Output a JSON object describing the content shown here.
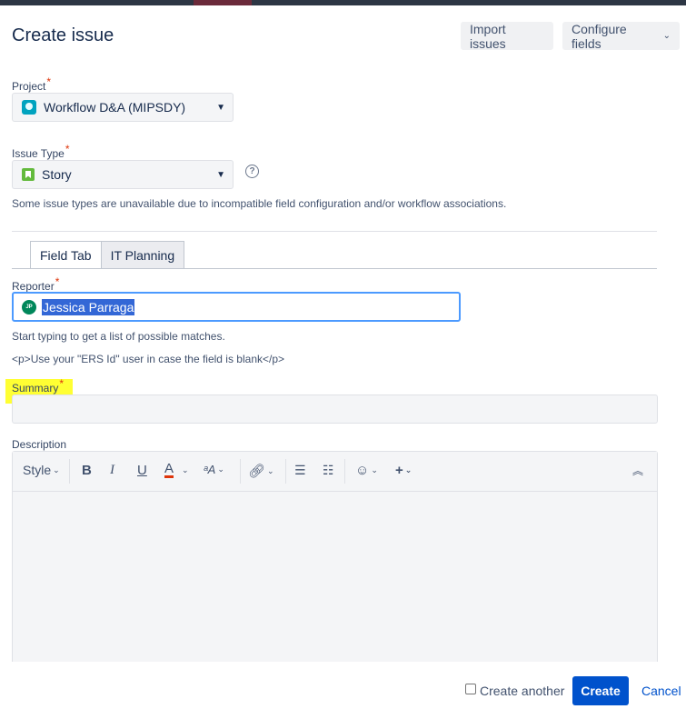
{
  "header": {
    "title": "Create issue",
    "import_label": "Import issues",
    "configure_label": "Configure fields"
  },
  "project": {
    "label": "Project",
    "required_mark": "*",
    "value": "Workflow D&A (MIPSDY)",
    "icon": "project-avatar-icon"
  },
  "issue_type": {
    "label": "Issue Type",
    "required_mark": "*",
    "value": "Story",
    "icon": "story-icon",
    "note": "Some issue types are unavailable due to incompatible field configuration and/or workflow associations."
  },
  "tabs": [
    {
      "label": "Field Tab",
      "active": true
    },
    {
      "label": "IT Planning",
      "active": false
    }
  ],
  "reporter": {
    "label": "Reporter",
    "required_mark": "*",
    "avatar_initials": "JP",
    "value": "Jessica Parraga",
    "hint1": "Start typing to get a list of possible matches.",
    "hint2": "<p>Use your \"ERS Id\" user in case the field is blank</p>"
  },
  "summary": {
    "label": "Summary",
    "required_mark": "*",
    "value": ""
  },
  "description": {
    "label": "Description",
    "toolbar": {
      "style": "Style",
      "bold": "B",
      "italic": "I",
      "underline": "U",
      "text_color": "A"
    }
  },
  "footer": {
    "create_another": "Create another",
    "create": "Create",
    "cancel": "Cancel"
  },
  "colors": {
    "primary": "#0052cc",
    "required": "#de350b",
    "highlight": "#ffff33",
    "focus": "#4c9aff"
  }
}
